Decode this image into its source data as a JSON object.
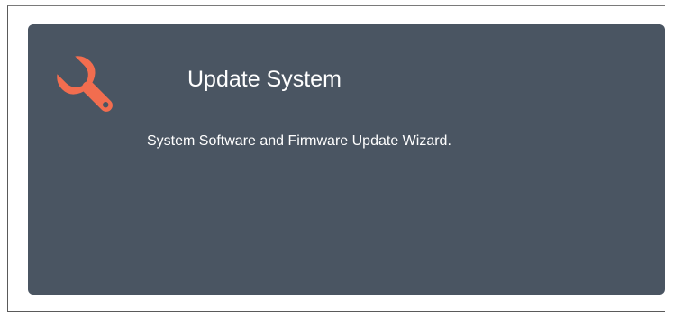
{
  "card": {
    "title": "Update System",
    "description": "System Software and Firmware Update Wizard.",
    "icon": "wrench-icon",
    "background_color": "#4a5562",
    "icon_color": "#f26d4f"
  }
}
